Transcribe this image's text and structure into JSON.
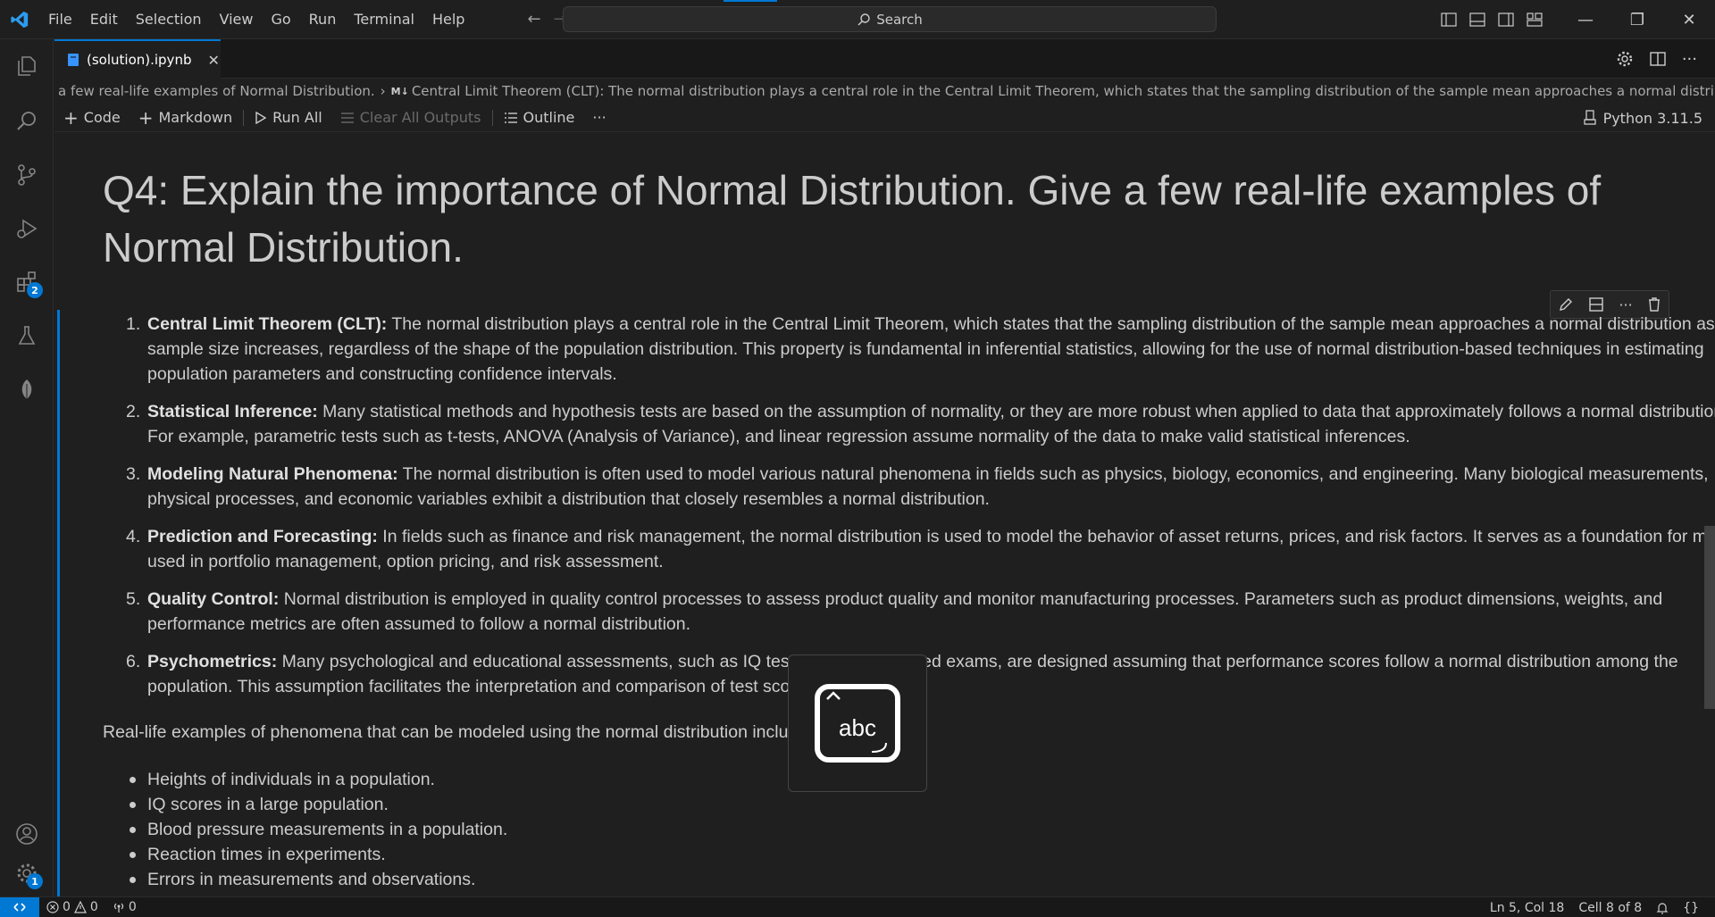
{
  "menu": [
    "File",
    "Edit",
    "Selection",
    "View",
    "Go",
    "Run",
    "Terminal",
    "Help"
  ],
  "search": {
    "label": "Search"
  },
  "tab": {
    "title": "(solution).ipynb"
  },
  "activity_badges": {
    "extensions": "2",
    "settings": "1"
  },
  "breadcrumb": {
    "part1": "a few real-life examples of Normal Distribution.",
    "part2_tag": "M↓",
    "part2": "Central Limit Theorem (CLT): The normal distribution plays a central role in the Central Limit Theorem, which states that the sampling distribution of the sample mean approaches a normal distribution as t..."
  },
  "toolbar": {
    "code": "Code",
    "markdown": "Markdown",
    "run_all": "Run All",
    "clear_outputs": "Clear All Outputs",
    "outline": "Outline",
    "more": "···",
    "kernel": "Python 3.11.5"
  },
  "notebook": {
    "heading_line1": "Q4: Explain the importance of Normal Distribution. Give a few real-life examples of",
    "heading_line2": "Normal Distribution.",
    "items": [
      {
        "num": "1.",
        "title": "Central Limit Theorem (CLT):",
        "text": " The normal distribution plays a central role in the Central Limit Theorem, which states that the sampling distribution of the sample mean approaches a normal distribution as the sample size increases, regardless of the shape of the population distribution. This property is fundamental in inferential statistics, allowing for the use of normal distribution-based techniques in estimating population parameters and constructing confidence intervals."
      },
      {
        "num": "2.",
        "title": "Statistical Inference:",
        "text": " Many statistical methods and hypothesis tests are based on the assumption of normality, or they are more robust when applied to data that approximately follows a normal distribution. For example, parametric tests such as t-tests, ANOVA (Analysis of Variance), and linear regression assume normality of the data to make valid statistical inferences."
      },
      {
        "num": "3.",
        "title": "Modeling Natural Phenomena:",
        "text": " The normal distribution is often used to model various natural phenomena in fields such as physics, biology, economics, and engineering. Many biological measurements, physical processes, and economic variables exhibit a distribution that closely resembles a normal distribution."
      },
      {
        "num": "4.",
        "title": "Prediction and Forecasting:",
        "text": " In fields such as finance and risk management, the normal distribution is used to model the behavior of asset returns, prices, and risk factors. It serves as a foundation for models used in portfolio management, option pricing, and risk assessment."
      },
      {
        "num": "5.",
        "title": "Quality Control:",
        "text": " Normal distribution is employed in quality control processes to assess product quality and monitor manufacturing processes. Parameters such as product dimensions, weights, and performance metrics are often assumed to follow a normal distribution."
      },
      {
        "num": "6.",
        "title": "Psychometrics:",
        "text": " Many psychological and educational assessments, such as IQ tests and standardized exams, are designed assuming that performance scores follow a normal distribution among the population. This assumption facilitates the interpretation and comparison of test scores."
      }
    ],
    "examples_intro": "Real-life examples of phenomena that can be modeled using the normal distribution include:",
    "examples": [
      "Heights of individuals in a population.",
      "IQ scores in a large population.",
      "Blood pressure measurements in a population.",
      "Reaction times in experiments.",
      "Errors in measurements and observations."
    ]
  },
  "ime": {
    "label": "abc"
  },
  "status": {
    "errors": "0",
    "warnings": "0",
    "ports": "0",
    "position": "Ln 5, Col 18",
    "cell": "Cell 8 of 8"
  }
}
